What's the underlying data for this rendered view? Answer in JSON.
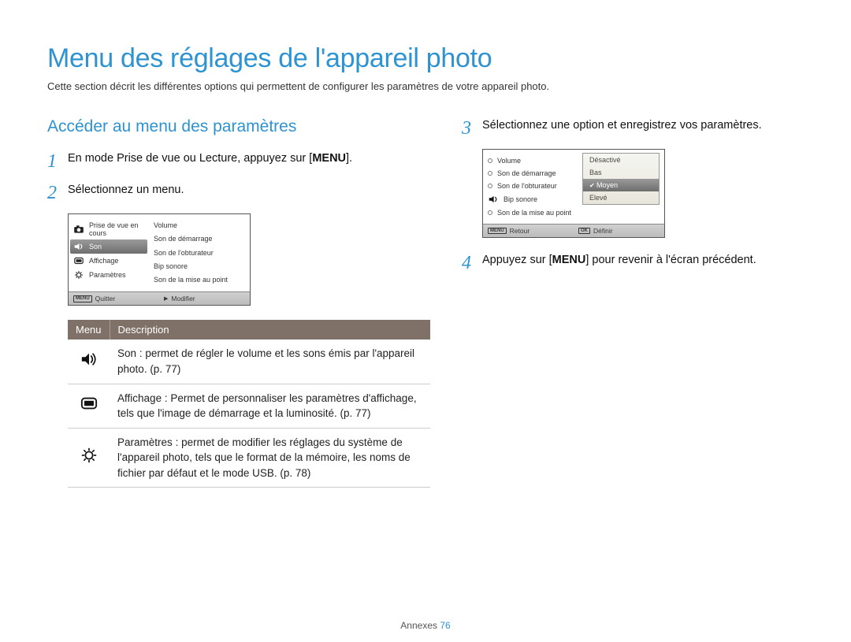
{
  "title": "Menu des réglages de l'appareil photo",
  "intro": "Cette section décrit les différentes options qui permettent de configurer les paramètres de votre appareil photo.",
  "subheading": "Accéder au menu des paramètres",
  "steps": {
    "s1_pre": "En mode Prise de vue ou Lecture, appuyez sur [",
    "s1_key": "MENU",
    "s1_post": "].",
    "s2": "Sélectionnez un menu.",
    "s3": "Sélectionnez une option et enregistrez vos paramètres.",
    "s4_pre": "Appuyez sur [",
    "s4_key": "MENU",
    "s4_post": "] pour revenir à l'écran précédent."
  },
  "lcd1": {
    "left": [
      "Prise de vue en cours",
      "Son",
      "Affichage",
      "Paramètres"
    ],
    "right": [
      "Volume",
      "Son de démarrage",
      "Son de l'obturateur",
      "Bip sonore",
      "Son de la mise au point"
    ],
    "foot_left_badge": "MENU",
    "foot_left": "Quitter",
    "foot_right_tri": "▶",
    "foot_right": "Modifier"
  },
  "lcd2": {
    "left": [
      "Volume",
      "Son de démarrage",
      "Son de l'obturateur",
      "Bip sonore",
      "Son de la mise au point"
    ],
    "popup": [
      "Désactivé",
      "Bas",
      "Moyen",
      "Elevé"
    ],
    "foot_left_badge": "MENU",
    "foot_left": "Retour",
    "foot_right_badge": "OK",
    "foot_right": "Définir"
  },
  "table": {
    "head": [
      "Menu",
      "Description"
    ],
    "rows": [
      {
        "bold": "Son",
        "text": " : permet de régler le volume et les sons émis par l'appareil photo. (p. 77)"
      },
      {
        "bold": "Affichage",
        "text": " : Permet de personnaliser les paramètres d'affichage, tels que l'image de démarrage et la luminosité. (p. 77)"
      },
      {
        "bold": "Paramètres",
        "text": " : permet de modifier les réglages du système de l'appareil photo, tels que le format de la mémoire, les noms de fichier par défaut et le mode USB. (p. 78)"
      }
    ]
  },
  "footer": {
    "label": "Annexes",
    "page": "76"
  }
}
